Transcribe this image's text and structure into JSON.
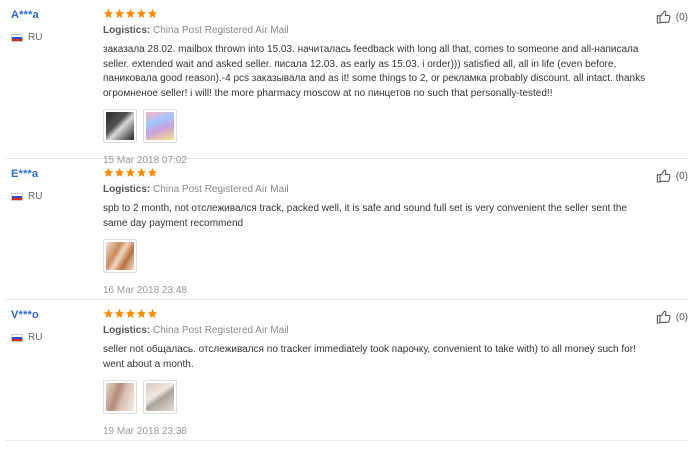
{
  "reviews": [
    {
      "user": "A***a",
      "country": "RU",
      "logistics_label": "Logistics:",
      "logistics_value": "China Post Registered Air Mail",
      "text": "заказала 28.02. mailbox thrown into 15.03. начиталась feedback with long all that, comes to someone and all-написала seller. extended wait and asked seller. писала 12.03. as early as 15.03. i order))) satisfied all, all in life (even before, паниковала good reason).-4 pcs заказывала and as it! some things to 2, or рекламка probably discount. all intact. thanks огромненое seller! i will! the more pharmacy moscow at no пинцетов no such that personally-tested!!",
      "date": "15 Mar 2018 07:02",
      "likes": "(0)",
      "photos": [
        "photo-dark-tools",
        "photo-colorful-pack"
      ]
    },
    {
      "user": "E***a",
      "country": "RU",
      "logistics_label": "Logistics:",
      "logistics_value": "China Post Registered Air Mail",
      "text": "spb to 2 month, not отслеживался track, packed well, it is safe and sound full set is very convenient the seller sent the same day payment recommend",
      "date": "16 Mar 2018 23:48",
      "likes": "(0)",
      "photos": [
        "photo-copper-tweezers"
      ]
    },
    {
      "user": "V***o",
      "country": "RU",
      "logistics_label": "Logistics:",
      "logistics_value": "China Post Registered Air Mail",
      "text": "seller not общалась. отслеживался no tracker immediately took парочку, convenient to take with) to all money such for! went about a month.",
      "date": "19 Mar 2018 23:38",
      "likes": "(0)",
      "photos": [
        "photo-hand-tweezers",
        "photo-silver-tweezers"
      ]
    }
  ]
}
